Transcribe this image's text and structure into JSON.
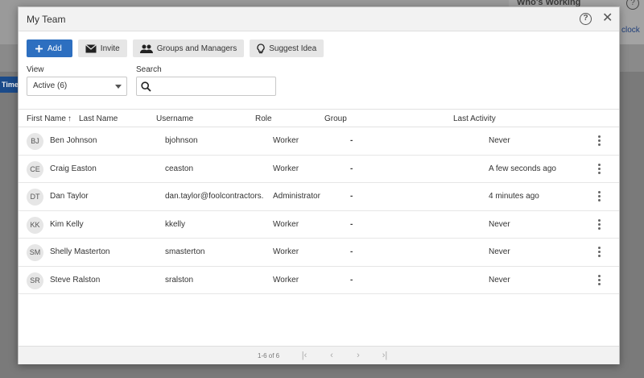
{
  "background": {
    "panel_title": "Who's Working",
    "clock_link": "clock",
    "time_tab": "Time"
  },
  "modal": {
    "title": "My Team",
    "help_icon": "?",
    "close_icon": "✕"
  },
  "toolbar": {
    "add_label": "Add",
    "invite_label": "Invite",
    "groups_label": "Groups and Managers",
    "suggest_label": "Suggest Idea"
  },
  "filters": {
    "view_label": "View",
    "view_value": "Active (6)",
    "search_label": "Search",
    "search_value": "",
    "search_placeholder": ""
  },
  "table": {
    "headers": {
      "first_name": "First Name",
      "last_name": "Last Name",
      "username": "Username",
      "role": "Role",
      "group": "Group",
      "last_activity": "Last Activity"
    },
    "rows": [
      {
        "initials": "BJ",
        "name": "Ben Johnson",
        "username": "bjohnson",
        "role": "Worker",
        "group": "-",
        "last_activity": "Never"
      },
      {
        "initials": "CE",
        "name": "Craig Easton",
        "username": "ceaston",
        "role": "Worker",
        "group": "-",
        "last_activity": "A few seconds ago"
      },
      {
        "initials": "DT",
        "name": "Dan Taylor",
        "username": "dan.taylor@foolcontractors.",
        "role": "Administrator",
        "group": "-",
        "last_activity": "4 minutes ago"
      },
      {
        "initials": "KK",
        "name": "Kim Kelly",
        "username": "kkelly",
        "role": "Worker",
        "group": "-",
        "last_activity": "Never"
      },
      {
        "initials": "SM",
        "name": "Shelly Masterton",
        "username": "smasterton",
        "role": "Worker",
        "group": "-",
        "last_activity": "Never"
      },
      {
        "initials": "SR",
        "name": "Steve Ralston",
        "username": "sralston",
        "role": "Worker",
        "group": "-",
        "last_activity": "Never"
      }
    ]
  },
  "pagination": {
    "range_text": "1-6 of 6",
    "first_icon": "|‹",
    "prev_icon": "‹",
    "next_icon": "›",
    "last_icon": "›|"
  },
  "colors": {
    "primary": "#2d6fc0",
    "header_bg": "#f2f2f2",
    "button_bg": "#e6e6e6"
  }
}
